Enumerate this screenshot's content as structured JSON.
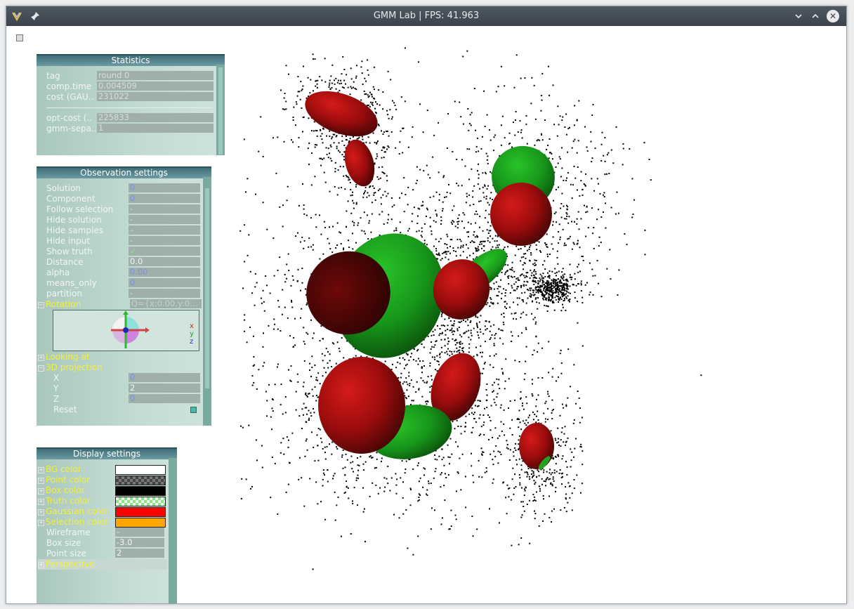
{
  "window": {
    "title": "GMM Lab | FPS: 41.963",
    "icons": [
      "app-logo-icon",
      "pin-icon"
    ],
    "controls": [
      "chevron-down-icon",
      "chevron-up-icon",
      "close-icon"
    ]
  },
  "statistics": {
    "title": "Statistics",
    "rows": [
      {
        "label": "tag",
        "value": "round 0"
      },
      {
        "label": "comp.time",
        "value": "0.004509"
      },
      {
        "label": "cost (GAU..",
        "value": "231022"
      },
      {
        "label": "opt-cost (..",
        "value": "225833"
      },
      {
        "label": "gmm-sepa..",
        "value": "1"
      }
    ]
  },
  "observation": {
    "title": "Observation settings",
    "rows": [
      {
        "label": "Solution",
        "value": "0"
      },
      {
        "label": "Component",
        "value": "0"
      },
      {
        "label": "Follow selection",
        "value": "-"
      },
      {
        "label": "Hide solution",
        "value": "-"
      },
      {
        "label": "Hide samples",
        "value": "-"
      },
      {
        "label": "Hide input",
        "value": "-"
      },
      {
        "label": "Show truth",
        "value": "✓"
      },
      {
        "label": "Distance",
        "value": "0.0"
      },
      {
        "label": "alpha",
        "value": "0.00"
      },
      {
        "label": "means_only",
        "value": "0"
      },
      {
        "label": "partition",
        "value": "-"
      }
    ],
    "rotation": {
      "label": "Rotation",
      "value": "Q={x:0.00,y:0..."
    },
    "axes": {
      "x": "x",
      "y": "y",
      "z": "z"
    },
    "looking_at": "Looking at",
    "projection": {
      "label": "3D projection",
      "x_label": "X",
      "x_value": "0",
      "y_label": "Y",
      "y_value": "2",
      "z_label": "Z",
      "z_value": "0",
      "reset_label": "Reset"
    }
  },
  "display": {
    "title": "Display settings",
    "colors": [
      {
        "label": "BG color",
        "color": "#ffffff",
        "pattern": "solid"
      },
      {
        "label": "Point color",
        "color": "#000000",
        "pattern": "checker-dark"
      },
      {
        "label": "Box color",
        "color": "#000000",
        "pattern": "solid"
      },
      {
        "label": "Truth color",
        "color": "#00ff00",
        "pattern": "checker-light"
      },
      {
        "label": "Gaussian color",
        "color": "#ff0000",
        "pattern": "solid"
      },
      {
        "label": "Selection color",
        "color": "#ffa500",
        "pattern": "solid"
      }
    ],
    "rows": [
      {
        "label": "Wireframe",
        "value": "-"
      },
      {
        "label": "Box size",
        "value": "-3.0"
      },
      {
        "label": "Point size",
        "value": "2"
      }
    ],
    "perspective": "Perspective"
  },
  "scene": {
    "truth_color": "#1fa51f",
    "gaussian_color": "#a50d0d",
    "point_color": "#000000"
  }
}
